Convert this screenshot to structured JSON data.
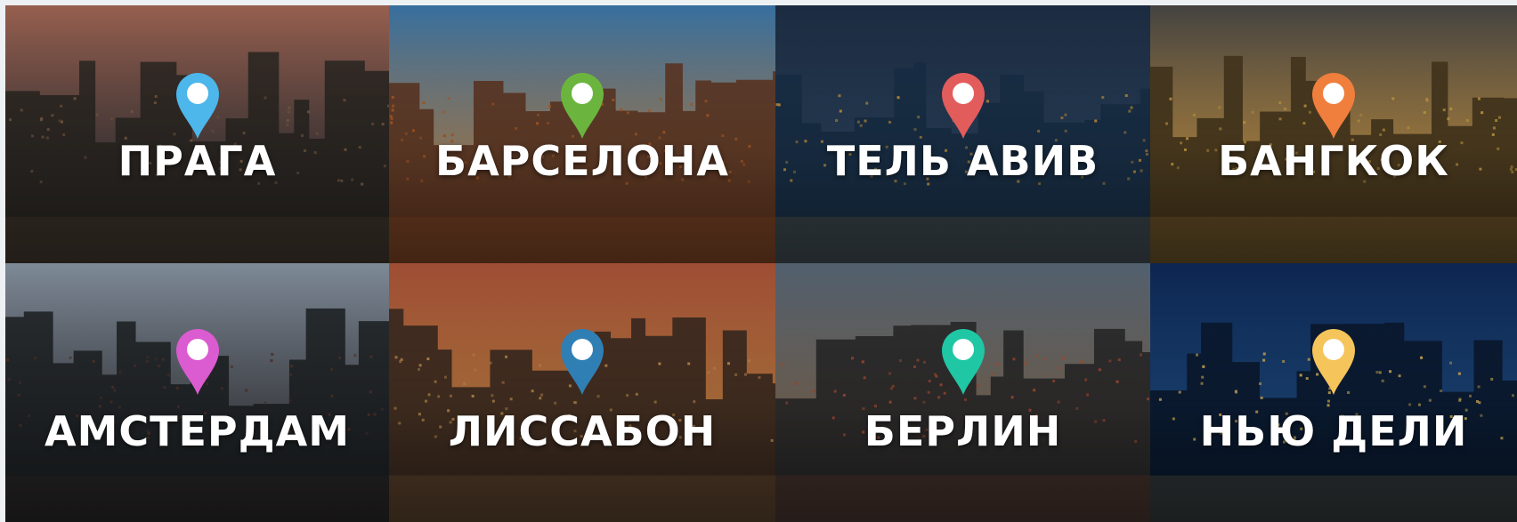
{
  "cities": [
    {
      "name": "ПРАГА",
      "pin_color": "#4db6ea",
      "sky_top": "#a86a58",
      "sky_bottom": "#5a4a48",
      "ground": "#2e2a26",
      "accent": "#8e6b4e"
    },
    {
      "name": "БАРСЕЛОНА",
      "pin_color": "#6bb53f",
      "sky_top": "#3d7bb0",
      "sky_bottom": "#b59a7a",
      "ground": "#6a3a22",
      "accent": "#c76a2a"
    },
    {
      "name": "ТЕЛЬ АВИВ",
      "pin_color": "#e35c5c",
      "sky_top": "#1f3047",
      "sky_bottom": "#2e4968",
      "ground": "#1b3550",
      "accent": "#d9a24a"
    },
    {
      "name": "БАНГКОК",
      "pin_color": "#f07e3c",
      "sky_top": "#4b4a48",
      "sky_bottom": "#c79a52",
      "ground": "#4a3a1e",
      "accent": "#e2b34c"
    },
    {
      "name": "АМСТЕРДАМ",
      "pin_color": "#db5bd0",
      "sky_top": "#8c99a8",
      "sky_bottom": "#5a5e66",
      "ground": "#1e2326",
      "accent": "#5b3a30"
    },
    {
      "name": "ЛИССАБОН",
      "pin_color": "#2f7fb5",
      "sky_top": "#b0563a",
      "sky_bottom": "#d98a4a",
      "ground": "#3a2a22",
      "accent": "#d8a05a"
    },
    {
      "name": "БЕРЛИН",
      "pin_color": "#1fc7a4",
      "sky_top": "#5a6a7a",
      "sky_bottom": "#8a7a6a",
      "ground": "#2a2a2c",
      "accent": "#c05a3a"
    },
    {
      "name": "НЬЮ ДЕЛИ",
      "pin_color": "#f5c45a",
      "sky_top": "#0e2a5a",
      "sky_bottom": "#1f4f8a",
      "ground": "#0a1a30",
      "accent": "#e8c060"
    }
  ]
}
